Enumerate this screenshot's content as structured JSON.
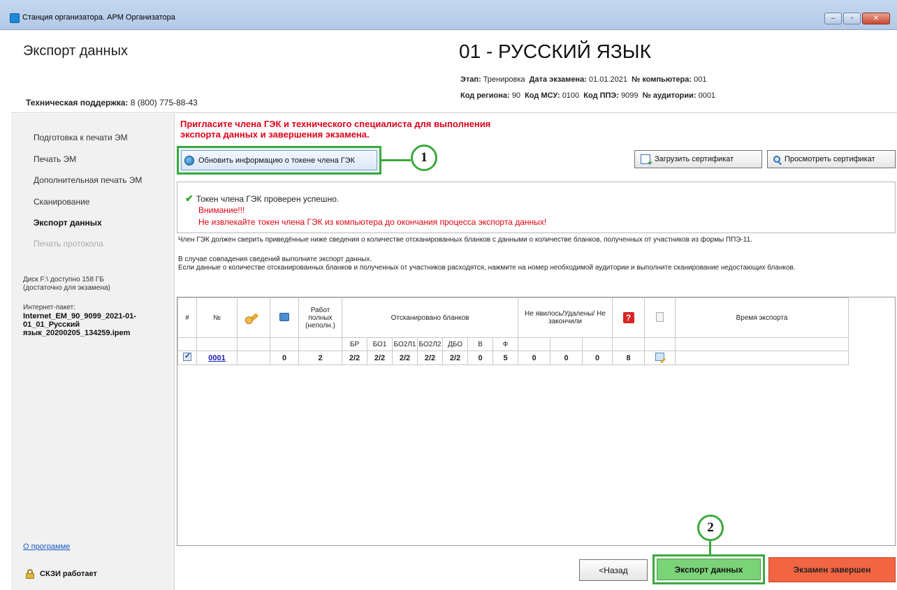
{
  "window": {
    "title": "Станция организатора. АРМ Организатора",
    "buttons": [
      "–",
      "▫",
      "✕"
    ]
  },
  "header": {
    "section_title": "Экспорт данных",
    "support_label": "Техническая поддержка:",
    "support_phone": "8 (800) 775-88-43",
    "subject": "01 - РУССКИЙ ЯЗЫК",
    "info_line1": [
      {
        "label": "Этап:",
        "value": "Тренировка"
      },
      {
        "label": "Дата экзамена:",
        "value": "01.01.2021"
      },
      {
        "label": "№ компьютера:",
        "value": "001"
      }
    ],
    "info_line2": [
      {
        "label": "Код региона:",
        "value": "90"
      },
      {
        "label": "Код МСУ:",
        "value": "0100"
      },
      {
        "label": "Код ППЭ:",
        "value": "9099"
      },
      {
        "label": "№ аудитории:",
        "value": "0001"
      }
    ]
  },
  "sidebar": {
    "items": [
      {
        "label": "Подготовка к печати ЭМ",
        "state": "normal"
      },
      {
        "label": "Печать ЭМ",
        "state": "normal"
      },
      {
        "label": "Дополнительная печать ЭМ",
        "state": "normal"
      },
      {
        "label": "Сканирование",
        "state": "normal"
      },
      {
        "label": "Экспорт данных",
        "state": "active"
      },
      {
        "label": "Печать протокола",
        "state": "disabled"
      }
    ],
    "disk_line1": "Диск F:\\ доступно 158 ГБ",
    "disk_line2": "(достаточно для экзамена)",
    "inet_label": "Интернет-пакет:",
    "inet_file": "Internet_EM_90_9099_2021-01-01_01_Русский язык_20200205_134259.ipem",
    "about": "О программе",
    "skzi": "СКЗИ работает"
  },
  "main": {
    "alert_line1": "Пригласите члена ГЭК и технического специалиста для выполнения",
    "alert_line2": "экспорта данных и завершения экзамена.",
    "refresh_button": "Обновить информацию о токене члена ГЭК",
    "upload_button": "Загрузить сертификат",
    "view_button": "Просмотреть сертификат",
    "status_ok": "Токен члена ГЭК проверен успешно.",
    "warning_title": "Внимание!!!",
    "warning_text": "Не извлекайте токен члена ГЭК из компьютера до окончания процесса экспорта данных!",
    "note1": "Член ГЭК должен сверить приведённые ниже сведения о количестве отсканированных бланков с данными о количестве бланков, полученных от участников из формы ППЭ-11.",
    "note2": "В случае совпадения сведений выполните экспорт данных.",
    "note3": "Если данные о количестве отсканированных бланков и полученных от участников расходятся, нажмите на номер необходимой аудитории и выполните сканирование недостающих бланков.",
    "callout1": "1",
    "callout2": "2"
  },
  "table": {
    "headers": {
      "hash": "#",
      "num": "№",
      "works": "Работ полных (неполн.)",
      "scanned": "Отсканировано бланков",
      "absent": "Не явилось/Удалены/ Не закончили",
      "question_icon": "?",
      "time": "Время экспорта"
    },
    "subheaders": [
      "БР",
      "БО1",
      "БО2Л1",
      "БО2Л2",
      "ДБО",
      "В",
      "Ф"
    ],
    "rows": [
      {
        "num": "0001",
        "printer": "0",
        "works": "2",
        "scanned": [
          "2/2",
          "2/2",
          "2/2",
          "2/2",
          "2/2",
          "0",
          "5"
        ],
        "absent": [
          "0",
          "0",
          "0"
        ],
        "q": "8"
      }
    ]
  },
  "footer": {
    "back": "<Назад",
    "export": "Экспорт данных",
    "finish": "Экзамен завершен"
  },
  "colors": {
    "accent_green": "#3aa93d",
    "export_fill": "#7bd377",
    "finish_fill": "#f26542",
    "alert_red": "#e0001b"
  }
}
